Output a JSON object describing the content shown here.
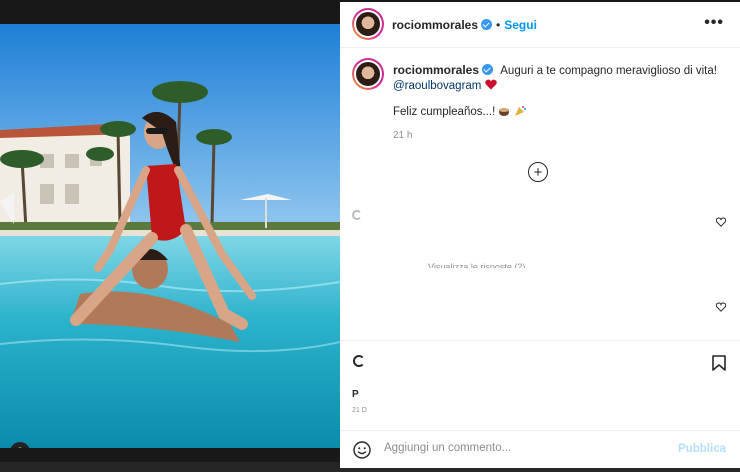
{
  "post": {
    "username": "rociommorales",
    "follow_label": "Segui",
    "more_label": "•••",
    "separator": "•"
  },
  "caption": {
    "username": "rociommorales",
    "text": "Auguri a te compagno meraviglioso di vita!",
    "mention": "@raoulbovagram",
    "second_line": "Feliz cumpleaños...!",
    "time_ago": "21 h"
  },
  "comments": {
    "view_replies": "Visualizza le risposte (2)"
  },
  "footer": {
    "likes_cut": "P",
    "date_cut": "21 D"
  },
  "comment_bar": {
    "placeholder": "Aggiungi un commento...",
    "publish_label": "Pubblica"
  },
  "colors": {
    "accent": "#0095f6",
    "verified": "#3897f0",
    "heart": "#ed4956"
  },
  "icons": [
    "more-icon",
    "plus-circle-icon",
    "heart-icon",
    "bookmark-icon",
    "emoji-icon",
    "user-tag-icon",
    "verified-badge-icon",
    "loading-spinner-icon"
  ]
}
